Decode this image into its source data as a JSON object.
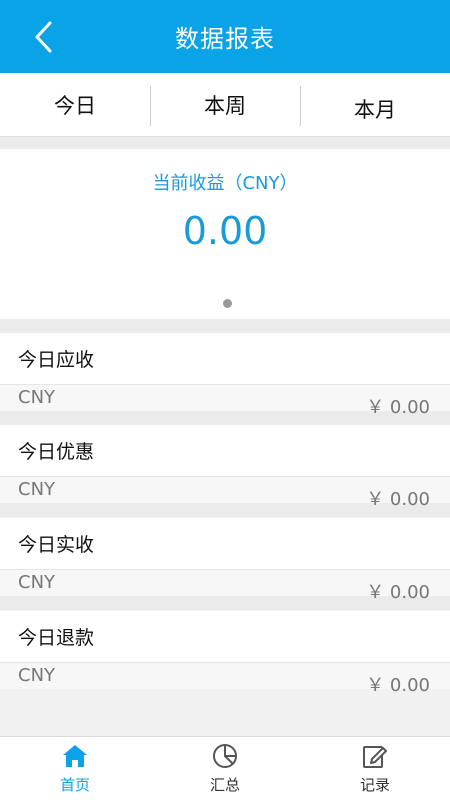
{
  "header": {
    "title": "数据报表",
    "back_icon": "back-icon"
  },
  "tabs": [
    {
      "label": "今日"
    },
    {
      "label": "本周"
    },
    {
      "label": "本月"
    }
  ],
  "summary": {
    "label": "当前收益（CNY）",
    "value": "0.00",
    "page_index": 1,
    "page_count": 1
  },
  "cards": [
    {
      "title": "今日应收",
      "currency": "CNY",
      "amount": "￥ 0.00"
    },
    {
      "title": "今日优惠",
      "currency": "CNY",
      "amount": "￥ 0.00"
    },
    {
      "title": "今日实收",
      "currency": "CNY",
      "amount": "￥ 0.00"
    },
    {
      "title": "今日退款",
      "currency": "CNY",
      "amount": "￥ 0.00"
    }
  ],
  "nav": [
    {
      "label": "首页",
      "icon": "home-icon",
      "active": true
    },
    {
      "label": "汇总",
      "icon": "pie-chart-icon",
      "active": false
    },
    {
      "label": "记录",
      "icon": "edit-icon",
      "active": false
    }
  ],
  "colors": {
    "primary": "#0aa3e8",
    "text_muted": "#777777"
  }
}
